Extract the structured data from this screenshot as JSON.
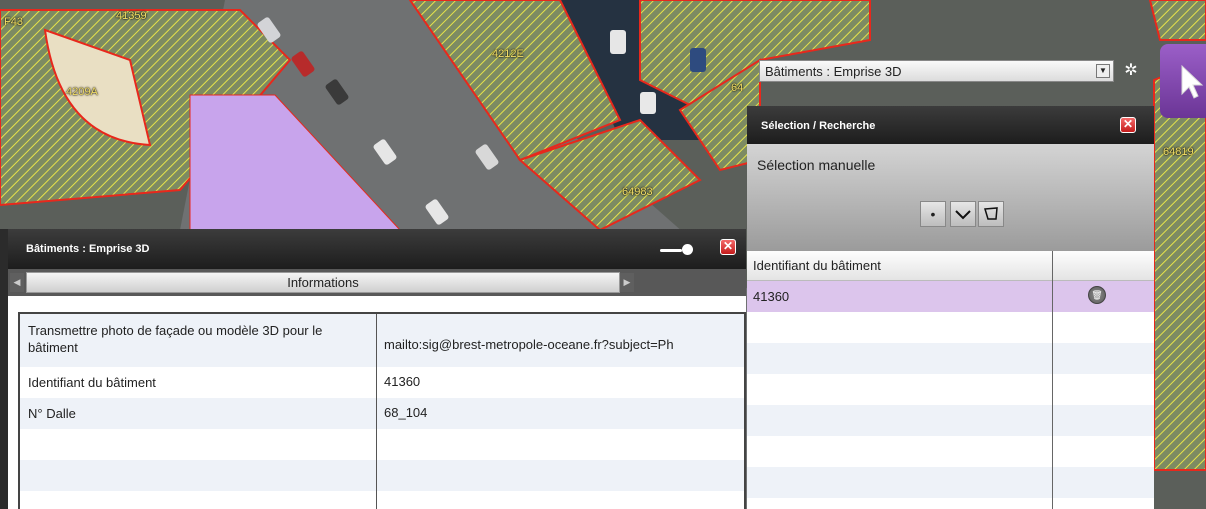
{
  "map": {
    "parcel_labels": [
      "F43",
      "41359",
      "4209A",
      "4212E",
      "64983",
      "64819",
      "64"
    ]
  },
  "info_panel": {
    "title": "Bâtiments : Emprise 3D",
    "tab_label": "Informations",
    "rows": [
      {
        "key": "Transmettre photo de façade ou modèle 3D pour le bâtiment",
        "value": "mailto:sig@brest-metropole-oceane.fr?subject=Ph"
      },
      {
        "key": "Identifiant du bâtiment",
        "value": "41360"
      },
      {
        "key": "N° Dalle",
        "value": "68_104"
      }
    ]
  },
  "layer_select": {
    "selected": "Bâtiments : Emprise 3D"
  },
  "selection_panel": {
    "title": "Sélection / Recherche",
    "manual_label": "Sélection manuelle",
    "column_header": "Identifiant du bâtiment",
    "rows": [
      "41360"
    ]
  },
  "icons": {
    "close": "close-icon",
    "delete": "trash-icon",
    "point_tool": "point-icon",
    "line_tool": "line-icon",
    "polygon_tool": "polygon-icon",
    "layer_tool": "settings-icon",
    "pointer": "cursor-icon"
  },
  "colors": {
    "parcel_outline": "#e8281c",
    "parcel_hatch": "#e6e34a",
    "selected_building": "#c8a4ec",
    "panel_dark": "#2b2b2b",
    "selected_row": "#dcc5ec",
    "pointer_tool": "#7f45ad"
  }
}
